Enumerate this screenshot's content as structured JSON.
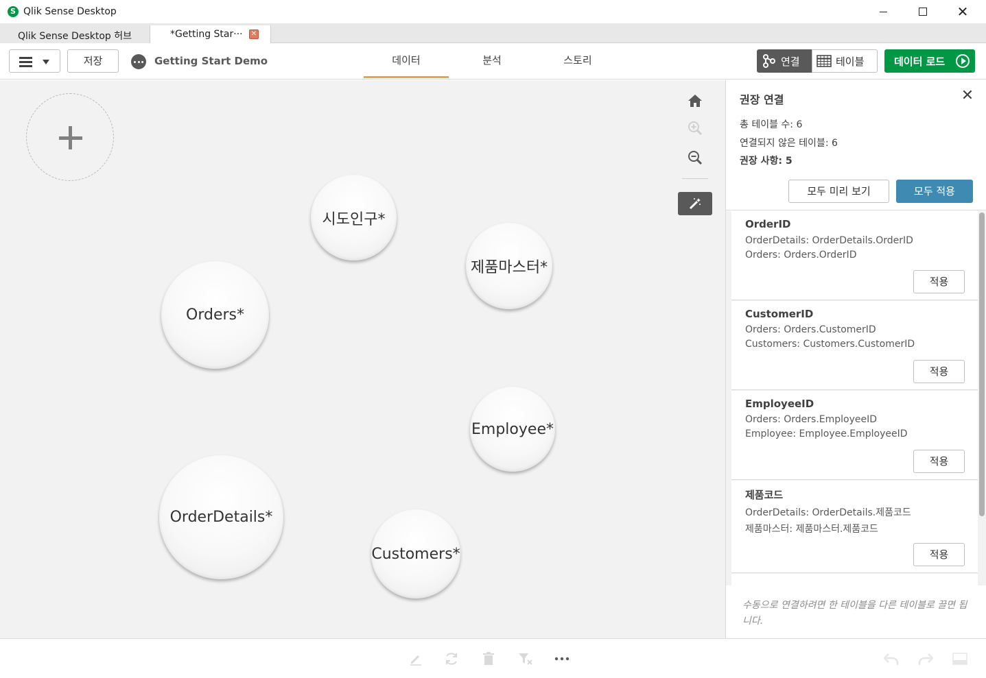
{
  "window": {
    "app_icon_letter": "S",
    "title": "Qlik Sense Desktop"
  },
  "tabs": [
    {
      "label": "Qlik Sense Desktop 허브"
    },
    {
      "label": "*Getting Star···"
    }
  ],
  "toolbar": {
    "save_label": "저장",
    "app_name": "Getting Start Demo",
    "nav": {
      "data": "데이터",
      "analysis": "분석",
      "story": "스토리"
    },
    "associations_label": "연결",
    "tables_label": "테이블",
    "load_data_label": "데이터 로드"
  },
  "canvas": {
    "tables": [
      {
        "name": "시도인구*"
      },
      {
        "name": "제품마스터*"
      },
      {
        "name": "Orders*"
      },
      {
        "name": "Employee*"
      },
      {
        "name": "OrderDetails*"
      },
      {
        "name": "Customers*"
      }
    ]
  },
  "panel": {
    "title": "권장 연결",
    "total_tables": "총 테이블 수: 6",
    "unlinked_tables": "연결되지 않은 테이블: 6",
    "recommendations": "권장 사항: 5",
    "preview_all": "모두 미리 보기",
    "apply_all": "모두 적용",
    "items": [
      {
        "field": "OrderID",
        "line1": "OrderDetails: OrderDetails.OrderID",
        "line2": "Orders: Orders.OrderID",
        "apply": "적용"
      },
      {
        "field": "CustomerID",
        "line1": "Orders: Orders.CustomerID",
        "line2": "Customers: Customers.CustomerID",
        "apply": "적용"
      },
      {
        "field": "EmployeeID",
        "line1": "Orders: Orders.EmployeeID",
        "line2": "Employee: Employee.EmployeeID",
        "apply": "적용"
      },
      {
        "field": "제품코드",
        "line1": "OrderDetails: OrderDetails.제품코드",
        "line2": "제품마스터: 제품마스터.제품코드",
        "apply": "적용"
      }
    ],
    "footer_hint": "수동으로 연결하려면 한 테이블을 다른 테이블로 끌면 됩니다."
  },
  "colors": {
    "green": "#009845",
    "blue": "#3f8ab3",
    "dark": "#595959",
    "active_tab": "#f0a33d"
  }
}
